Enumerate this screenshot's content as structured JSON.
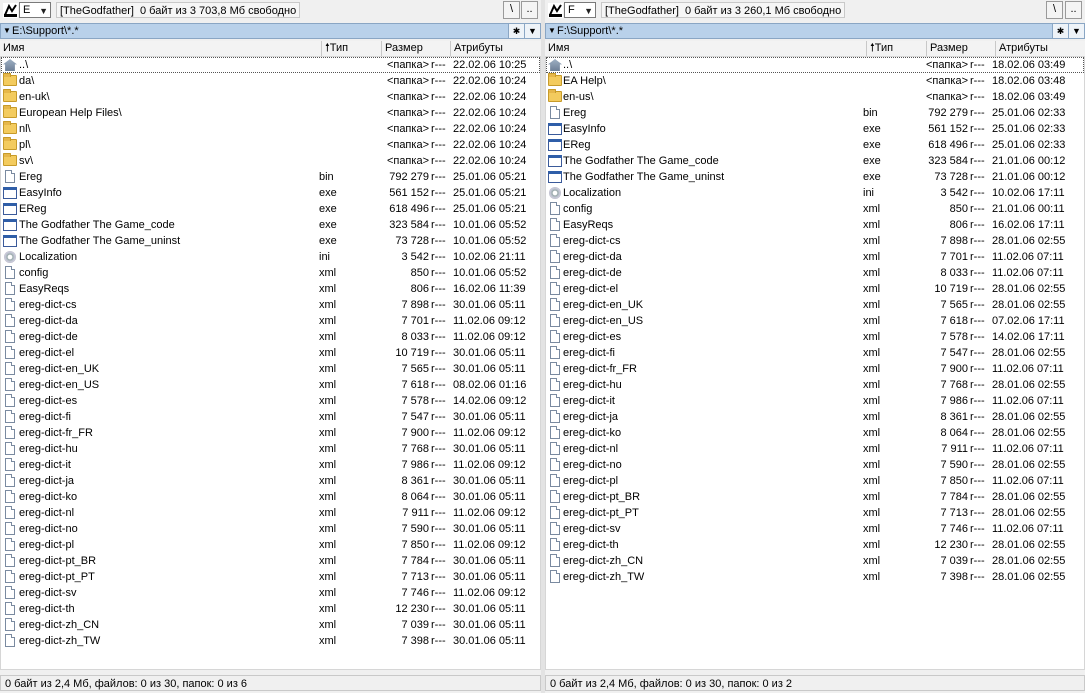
{
  "left": {
    "drive": "E",
    "label": "[TheGodfather]",
    "free": "0 байт из 3 703,8 Мб свободно",
    "root_btn": "\\",
    "up_btn": "..",
    "path": "E:\\Support\\*.*",
    "headers": {
      "name": "Имя",
      "type": "Тип",
      "size": "Размер",
      "attrs": "Атрибуты"
    },
    "rows": [
      {
        "icon": "up",
        "name": "..\\",
        "ext": "",
        "size": "<папка>",
        "attr": "r---",
        "date": "22.02.06 10:25"
      },
      {
        "icon": "folder",
        "name": "da\\",
        "ext": "",
        "size": "<папка>",
        "attr": "r---",
        "date": "22.02.06 10:24"
      },
      {
        "icon": "folder",
        "name": "en-uk\\",
        "ext": "",
        "size": "<папка>",
        "attr": "r---",
        "date": "22.02.06 10:24"
      },
      {
        "icon": "folder",
        "name": "European Help Files\\",
        "ext": "",
        "size": "<папка>",
        "attr": "r---",
        "date": "22.02.06 10:24"
      },
      {
        "icon": "folder",
        "name": "nl\\",
        "ext": "",
        "size": "<папка>",
        "attr": "r---",
        "date": "22.02.06 10:24"
      },
      {
        "icon": "folder",
        "name": "pl\\",
        "ext": "",
        "size": "<папка>",
        "attr": "r---",
        "date": "22.02.06 10:24"
      },
      {
        "icon": "folder",
        "name": "sv\\",
        "ext": "",
        "size": "<папка>",
        "attr": "r---",
        "date": "22.02.06 10:24"
      },
      {
        "icon": "file",
        "name": "Ereg",
        "ext": "bin",
        "size": "792 279",
        "attr": "r---",
        "date": "25.01.06 05:21"
      },
      {
        "icon": "exe",
        "name": "EasyInfo",
        "ext": "exe",
        "size": "561 152",
        "attr": "r---",
        "date": "25.01.06 05:21"
      },
      {
        "icon": "exe",
        "name": "EReg",
        "ext": "exe",
        "size": "618 496",
        "attr": "r---",
        "date": "25.01.06 05:21"
      },
      {
        "icon": "exe",
        "name": "The Godfather The Game_code",
        "ext": "exe",
        "size": "323 584",
        "attr": "r---",
        "date": "10.01.06 05:52"
      },
      {
        "icon": "exe",
        "name": "The Godfather The Game_uninst",
        "ext": "exe",
        "size": "73 728",
        "attr": "r---",
        "date": "10.01.06 05:52"
      },
      {
        "icon": "ini",
        "name": "Localization",
        "ext": "ini",
        "size": "3 542",
        "attr": "r---",
        "date": "10.02.06 21:11"
      },
      {
        "icon": "file",
        "name": "config",
        "ext": "xml",
        "size": "850",
        "attr": "r---",
        "date": "10.01.06 05:52"
      },
      {
        "icon": "file",
        "name": "EasyReqs",
        "ext": "xml",
        "size": "806",
        "attr": "r---",
        "date": "16.02.06 11:39"
      },
      {
        "icon": "file",
        "name": "ereg-dict-cs",
        "ext": "xml",
        "size": "7 898",
        "attr": "r---",
        "date": "30.01.06 05:11"
      },
      {
        "icon": "file",
        "name": "ereg-dict-da",
        "ext": "xml",
        "size": "7 701",
        "attr": "r---",
        "date": "11.02.06 09:12"
      },
      {
        "icon": "file",
        "name": "ereg-dict-de",
        "ext": "xml",
        "size": "8 033",
        "attr": "r---",
        "date": "11.02.06 09:12"
      },
      {
        "icon": "file",
        "name": "ereg-dict-el",
        "ext": "xml",
        "size": "10 719",
        "attr": "r---",
        "date": "30.01.06 05:11"
      },
      {
        "icon": "file",
        "name": "ereg-dict-en_UK",
        "ext": "xml",
        "size": "7 565",
        "attr": "r---",
        "date": "30.01.06 05:11"
      },
      {
        "icon": "file",
        "name": "ereg-dict-en_US",
        "ext": "xml",
        "size": "7 618",
        "attr": "r---",
        "date": "08.02.06 01:16"
      },
      {
        "icon": "file",
        "name": "ereg-dict-es",
        "ext": "xml",
        "size": "7 578",
        "attr": "r---",
        "date": "14.02.06 09:12"
      },
      {
        "icon": "file",
        "name": "ereg-dict-fi",
        "ext": "xml",
        "size": "7 547",
        "attr": "r---",
        "date": "30.01.06 05:11"
      },
      {
        "icon": "file",
        "name": "ereg-dict-fr_FR",
        "ext": "xml",
        "size": "7 900",
        "attr": "r---",
        "date": "11.02.06 09:12"
      },
      {
        "icon": "file",
        "name": "ereg-dict-hu",
        "ext": "xml",
        "size": "7 768",
        "attr": "r---",
        "date": "30.01.06 05:11"
      },
      {
        "icon": "file",
        "name": "ereg-dict-it",
        "ext": "xml",
        "size": "7 986",
        "attr": "r---",
        "date": "11.02.06 09:12"
      },
      {
        "icon": "file",
        "name": "ereg-dict-ja",
        "ext": "xml",
        "size": "8 361",
        "attr": "r---",
        "date": "30.01.06 05:11"
      },
      {
        "icon": "file",
        "name": "ereg-dict-ko",
        "ext": "xml",
        "size": "8 064",
        "attr": "r---",
        "date": "30.01.06 05:11"
      },
      {
        "icon": "file",
        "name": "ereg-dict-nl",
        "ext": "xml",
        "size": "7 911",
        "attr": "r---",
        "date": "11.02.06 09:12"
      },
      {
        "icon": "file",
        "name": "ereg-dict-no",
        "ext": "xml",
        "size": "7 590",
        "attr": "r---",
        "date": "30.01.06 05:11"
      },
      {
        "icon": "file",
        "name": "ereg-dict-pl",
        "ext": "xml",
        "size": "7 850",
        "attr": "r---",
        "date": "11.02.06 09:12"
      },
      {
        "icon": "file",
        "name": "ereg-dict-pt_BR",
        "ext": "xml",
        "size": "7 784",
        "attr": "r---",
        "date": "30.01.06 05:11"
      },
      {
        "icon": "file",
        "name": "ereg-dict-pt_PT",
        "ext": "xml",
        "size": "7 713",
        "attr": "r---",
        "date": "30.01.06 05:11"
      },
      {
        "icon": "file",
        "name": "ereg-dict-sv",
        "ext": "xml",
        "size": "7 746",
        "attr": "r---",
        "date": "11.02.06 09:12"
      },
      {
        "icon": "file",
        "name": "ereg-dict-th",
        "ext": "xml",
        "size": "12 230",
        "attr": "r---",
        "date": "30.01.06 05:11"
      },
      {
        "icon": "file",
        "name": "ereg-dict-zh_CN",
        "ext": "xml",
        "size": "7 039",
        "attr": "r---",
        "date": "30.01.06 05:11"
      },
      {
        "icon": "file",
        "name": "ereg-dict-zh_TW",
        "ext": "xml",
        "size": "7 398",
        "attr": "r---",
        "date": "30.01.06 05:11"
      }
    ],
    "status": "0 байт из 2,4 Мб, файлов: 0 из 30, папок: 0 из 6"
  },
  "right": {
    "drive": "F",
    "label": "[TheGodfather]",
    "free": "0 байт из 3 260,1 Мб свободно",
    "root_btn": "\\",
    "up_btn": "..",
    "path": "F:\\Support\\*.*",
    "headers": {
      "name": "Имя",
      "type": "Тип",
      "size": "Размер",
      "attrs": "Атрибуты"
    },
    "rows": [
      {
        "icon": "up",
        "name": "..\\",
        "ext": "",
        "size": "<папка>",
        "attr": "r---",
        "date": "18.02.06 03:49"
      },
      {
        "icon": "folder",
        "name": "EA Help\\",
        "ext": "",
        "size": "<папка>",
        "attr": "r---",
        "date": "18.02.06 03:48"
      },
      {
        "icon": "folder",
        "name": "en-us\\",
        "ext": "",
        "size": "<папка>",
        "attr": "r---",
        "date": "18.02.06 03:49"
      },
      {
        "icon": "file",
        "name": "Ereg",
        "ext": "bin",
        "size": "792 279",
        "attr": "r---",
        "date": "25.01.06 02:33"
      },
      {
        "icon": "exe",
        "name": "EasyInfo",
        "ext": "exe",
        "size": "561 152",
        "attr": "r---",
        "date": "25.01.06 02:33"
      },
      {
        "icon": "exe",
        "name": "EReg",
        "ext": "exe",
        "size": "618 496",
        "attr": "r---",
        "date": "25.01.06 02:33"
      },
      {
        "icon": "exe",
        "name": "The Godfather The Game_code",
        "ext": "exe",
        "size": "323 584",
        "attr": "r---",
        "date": "21.01.06 00:12"
      },
      {
        "icon": "exe",
        "name": "The Godfather The Game_uninst",
        "ext": "exe",
        "size": "73 728",
        "attr": "r---",
        "date": "21.01.06 00:12"
      },
      {
        "icon": "ini",
        "name": "Localization",
        "ext": "ini",
        "size": "3 542",
        "attr": "r---",
        "date": "10.02.06 17:11"
      },
      {
        "icon": "file",
        "name": "config",
        "ext": "xml",
        "size": "850",
        "attr": "r---",
        "date": "21.01.06 00:11"
      },
      {
        "icon": "file",
        "name": "EasyReqs",
        "ext": "xml",
        "size": "806",
        "attr": "r---",
        "date": "16.02.06 17:11"
      },
      {
        "icon": "file",
        "name": "ereg-dict-cs",
        "ext": "xml",
        "size": "7 898",
        "attr": "r---",
        "date": "28.01.06 02:55"
      },
      {
        "icon": "file",
        "name": "ereg-dict-da",
        "ext": "xml",
        "size": "7 701",
        "attr": "r---",
        "date": "11.02.06 07:11"
      },
      {
        "icon": "file",
        "name": "ereg-dict-de",
        "ext": "xml",
        "size": "8 033",
        "attr": "r---",
        "date": "11.02.06 07:11"
      },
      {
        "icon": "file",
        "name": "ereg-dict-el",
        "ext": "xml",
        "size": "10 719",
        "attr": "r---",
        "date": "28.01.06 02:55"
      },
      {
        "icon": "file",
        "name": "ereg-dict-en_UK",
        "ext": "xml",
        "size": "7 565",
        "attr": "r---",
        "date": "28.01.06 02:55"
      },
      {
        "icon": "file",
        "name": "ereg-dict-en_US",
        "ext": "xml",
        "size": "7 618",
        "attr": "r---",
        "date": "07.02.06 17:11"
      },
      {
        "icon": "file",
        "name": "ereg-dict-es",
        "ext": "xml",
        "size": "7 578",
        "attr": "r---",
        "date": "14.02.06 17:11"
      },
      {
        "icon": "file",
        "name": "ereg-dict-fi",
        "ext": "xml",
        "size": "7 547",
        "attr": "r---",
        "date": "28.01.06 02:55"
      },
      {
        "icon": "file",
        "name": "ereg-dict-fr_FR",
        "ext": "xml",
        "size": "7 900",
        "attr": "r---",
        "date": "11.02.06 07:11"
      },
      {
        "icon": "file",
        "name": "ereg-dict-hu",
        "ext": "xml",
        "size": "7 768",
        "attr": "r---",
        "date": "28.01.06 02:55"
      },
      {
        "icon": "file",
        "name": "ereg-dict-it",
        "ext": "xml",
        "size": "7 986",
        "attr": "r---",
        "date": "11.02.06 07:11"
      },
      {
        "icon": "file",
        "name": "ereg-dict-ja",
        "ext": "xml",
        "size": "8 361",
        "attr": "r---",
        "date": "28.01.06 02:55"
      },
      {
        "icon": "file",
        "name": "ereg-dict-ko",
        "ext": "xml",
        "size": "8 064",
        "attr": "r---",
        "date": "28.01.06 02:55"
      },
      {
        "icon": "file",
        "name": "ereg-dict-nl",
        "ext": "xml",
        "size": "7 911",
        "attr": "r---",
        "date": "11.02.06 07:11"
      },
      {
        "icon": "file",
        "name": "ereg-dict-no",
        "ext": "xml",
        "size": "7 590",
        "attr": "r---",
        "date": "28.01.06 02:55"
      },
      {
        "icon": "file",
        "name": "ereg-dict-pl",
        "ext": "xml",
        "size": "7 850",
        "attr": "r---",
        "date": "11.02.06 07:11"
      },
      {
        "icon": "file",
        "name": "ereg-dict-pt_BR",
        "ext": "xml",
        "size": "7 784",
        "attr": "r---",
        "date": "28.01.06 02:55"
      },
      {
        "icon": "file",
        "name": "ereg-dict-pt_PT",
        "ext": "xml",
        "size": "7 713",
        "attr": "r---",
        "date": "28.01.06 02:55"
      },
      {
        "icon": "file",
        "name": "ereg-dict-sv",
        "ext": "xml",
        "size": "7 746",
        "attr": "r---",
        "date": "11.02.06 07:11"
      },
      {
        "icon": "file",
        "name": "ereg-dict-th",
        "ext": "xml",
        "size": "12 230",
        "attr": "r---",
        "date": "28.01.06 02:55"
      },
      {
        "icon": "file",
        "name": "ereg-dict-zh_CN",
        "ext": "xml",
        "size": "7 039",
        "attr": "r---",
        "date": "28.01.06 02:55"
      },
      {
        "icon": "file",
        "name": "ereg-dict-zh_TW",
        "ext": "xml",
        "size": "7 398",
        "attr": "r---",
        "date": "28.01.06 02:55"
      }
    ],
    "status": "0 байт из 2,4 Мб, файлов: 0 из 30, папок: 0 из 2"
  },
  "icons": {
    "drive": "drive-icon",
    "dropdown": "chevron-down-icon",
    "path_menu": "dropdown-arrow-icon",
    "hotlist": "star-icon",
    "history": "chevron-down-icon",
    "sort": "sort-ascending-icon",
    "up_dir": "up-arrow-icon",
    "folder": "folder-icon",
    "file": "file-icon",
    "exe": "application-icon",
    "ini": "settings-file-icon"
  },
  "colors": {
    "path_bar": "#b9d1ea",
    "background": "#f0f0f0",
    "list_background": "#ffffff"
  }
}
